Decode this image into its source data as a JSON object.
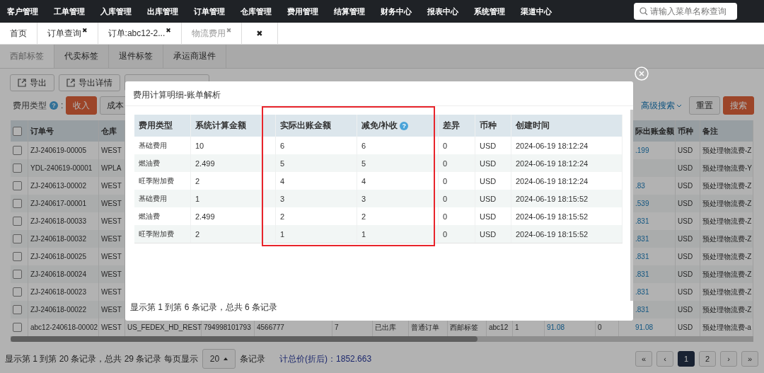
{
  "nav": {
    "items": [
      "客户管理",
      "工单管理",
      "入库管理",
      "出库管理",
      "订单管理",
      "仓库管理",
      "费用管理",
      "结算管理",
      "财务中心",
      "报表中心",
      "系统管理",
      "渠道中心"
    ],
    "search": {
      "placeholder": "请输入菜单名称查询"
    }
  },
  "tabs": [
    {
      "label": "首页",
      "selected": false
    },
    {
      "label": "订单查询",
      "close": "✖",
      "selected": false
    },
    {
      "label": "订单:abc12-2...",
      "close": "✖",
      "selected": false
    },
    {
      "label": "物流费用",
      "close": "✖",
      "selected": true
    },
    {
      "close": "✖",
      "selected": false
    }
  ],
  "sub_tabs": [
    {
      "label": "西邮标签",
      "selected": true
    },
    {
      "label": "代卖标签",
      "selected": false
    },
    {
      "label": "退件标签",
      "selected": false
    },
    {
      "label": "承运商退件",
      "selected": false
    }
  ],
  "toolbar": [
    {
      "label": "导出"
    },
    {
      "label": "导出详情"
    }
  ],
  "filter": {
    "label": "费用类型",
    "help": "?",
    "colon": ":",
    "options": [
      {
        "label": "收入",
        "selected": true
      },
      {
        "label": "成本",
        "selected": false
      }
    ],
    "advanced": "高级搜索",
    "reset": "重置",
    "search": "搜索"
  },
  "table": {
    "all_checked": false,
    "columns": {
      "order_no": "订单号",
      "warehouse": "仓库",
      "actual_amount": "际出账金额",
      "currency": "币种",
      "remark": "备注"
    },
    "rows": [
      {
        "checked": false,
        "order_no": "ZJ-240619-00005",
        "warehouse": "WEST",
        "actual_amount": ".199",
        "currency": "USD",
        "remark": "预处理物流费-Z"
      },
      {
        "checked": false,
        "order_no": "YDL-240619-00001",
        "warehouse": "WPLA",
        "currency": "USD",
        "remark": "预处理物流费-Y"
      },
      {
        "checked": false,
        "order_no": "ZJ-240613-00002",
        "warehouse": "WEST",
        "actual_amount": ".83",
        "currency": "USD",
        "remark": "预处理物流费-Z"
      },
      {
        "checked": false,
        "order_no": "ZJ-240617-00001",
        "warehouse": "WEST",
        "actual_amount": ".539",
        "currency": "USD",
        "remark": "预处理物流费-Z"
      },
      {
        "checked": false,
        "order_no": "ZJ-240618-00033",
        "warehouse": "WEST",
        "actual_amount": ".831",
        "currency": "USD",
        "remark": "预处理物流费-Z"
      },
      {
        "checked": false,
        "order_no": "ZJ-240618-00032",
        "warehouse": "WEST",
        "actual_amount": ".831",
        "currency": "USD",
        "remark": "预处理物流费-Z"
      },
      {
        "checked": false,
        "order_no": "ZJ-240618-00025",
        "warehouse": "WEST",
        "actual_amount": ".831",
        "currency": "USD",
        "remark": "预处理物流费-Z"
      },
      {
        "checked": false,
        "order_no": "ZJ-240618-00024",
        "warehouse": "WEST",
        "actual_amount": ".831",
        "currency": "USD",
        "remark": "预处理物流费-Z"
      },
      {
        "checked": false,
        "order_no": "ZJ-240618-00023",
        "warehouse": "WEST",
        "actual_amount": ".831",
        "currency": "USD",
        "remark": "预处理物流费-Z"
      },
      {
        "checked": false,
        "order_no": "ZJ-240618-00022",
        "warehouse": "WEST",
        "actual_amount": ".831",
        "currency": "USD",
        "remark": "预处理物流费-Z"
      },
      {
        "checked": false,
        "order_no": "abc12-240618-00002",
        "warehouse": "WEST",
        "channel": "US_FEDEX_HD_REST",
        "tracking_no": "794998101793",
        "column_5": "4566777",
        "column_6": "7",
        "status": "已出库",
        "order_type": "普通订单",
        "label_type": "西邮标签",
        "customer": "abc12",
        "column_11": "1",
        "amount": "91.08",
        "column_13": "0",
        "actual_amount": "91.08",
        "currency": "USD",
        "remark": "预处理物流费-a"
      }
    ]
  },
  "footer": {
    "summary": "显示第 1 到第 20 条记录，总共 29 条记录 每页显示",
    "page_size": "20",
    "unit": "条记录",
    "total": "计总价(折后)：1852.663",
    "pages": [
      {
        "label": "«",
        "selected": false
      },
      {
        "label": "‹",
        "selected": false
      },
      {
        "label": "1",
        "selected": true
      },
      {
        "label": "2",
        "selected": false
      },
      {
        "label": "›",
        "selected": false
      },
      {
        "label": "»",
        "selected": false
      }
    ]
  },
  "modal": {
    "title": "费用计算明细-账单解析",
    "columns": [
      {
        "label": "费用类型"
      },
      {
        "label": "系统计算金额"
      },
      {},
      {
        "label": "实际出账金额"
      },
      {
        "label": "减免/补收",
        "help": "?"
      },
      {
        "label": "差异"
      },
      {
        "label": "币种"
      },
      {
        "label": "创建时间"
      }
    ],
    "rows": [
      [
        "基础费用",
        "10",
        null,
        "6",
        "6",
        "0",
        "USD",
        "2024-06-19 18:12:24"
      ],
      [
        "燃油费",
        "2.499",
        null,
        "5",
        "5",
        "0",
        "USD",
        "2024-06-19 18:12:24"
      ],
      [
        "旺季附加费",
        "2",
        null,
        "4",
        "4",
        "0",
        "USD",
        "2024-06-19 18:12:24"
      ],
      [
        "基础费用",
        "1",
        null,
        "3",
        "3",
        "0",
        "USD",
        "2024-06-19 18:15:52"
      ],
      [
        "燃油费",
        "2.499",
        null,
        "2",
        "2",
        "0",
        "USD",
        "2024-06-19 18:15:52"
      ],
      [
        "旺季附加费",
        "2",
        null,
        "1",
        "1",
        "0",
        "USD",
        "2024-06-19 18:15:52"
      ]
    ],
    "summary": "显示第 1 到第 6 条记录，总共 6 条记录"
  }
}
